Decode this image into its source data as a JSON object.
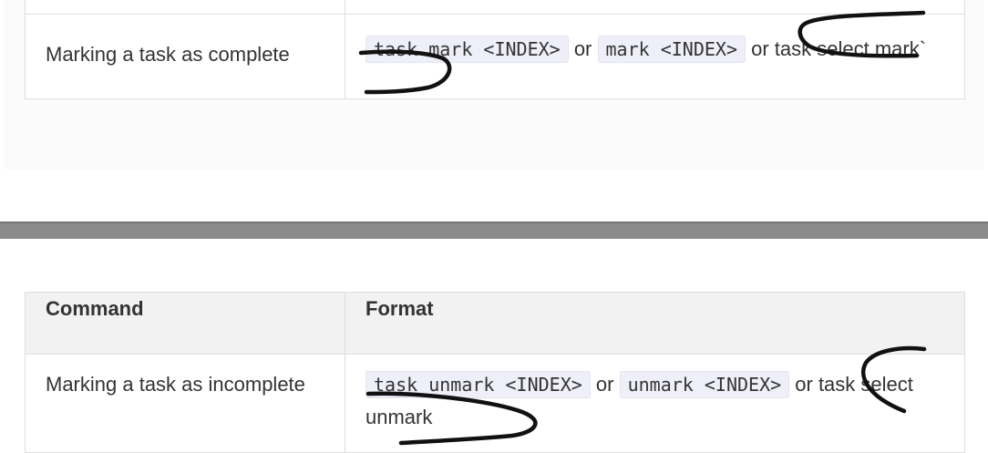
{
  "table_top": {
    "row": {
      "command": "Marking a task as complete",
      "format": [
        {
          "type": "code",
          "text": "task mark <INDEX>"
        },
        {
          "type": "text",
          "text": " or "
        },
        {
          "type": "code",
          "text": "mark <INDEX>"
        },
        {
          "type": "text",
          "text": " or task select mark`"
        }
      ]
    }
  },
  "table_bottom": {
    "headers": {
      "command": "Command",
      "format": "Format"
    },
    "row": {
      "command": "Marking a task as incomplete",
      "format": [
        {
          "type": "code",
          "text": "task unmark <INDEX>"
        },
        {
          "type": "text",
          "text": " or "
        },
        {
          "type": "code",
          "text": "unmark <INDEX>"
        },
        {
          "type": "text",
          "text": " or task select unmark"
        }
      ]
    }
  },
  "colors": {
    "annotation": "#111111",
    "code_bg": "#eeeff8",
    "border": "#dedede",
    "divider": "#8a8a8a"
  }
}
